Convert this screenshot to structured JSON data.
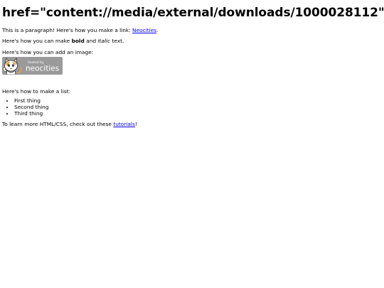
{
  "heading": "href=\"content://media/external/downloads/1000028112\"",
  "paragraph1": {
    "before": "This is a paragraph! Here's how you make a link: ",
    "link": "Neocities",
    "after": "."
  },
  "paragraph2": {
    "before": "Here's how you can make ",
    "bold": "bold",
    "middle": " and ",
    "italic": "italic",
    "after": " text."
  },
  "paragraph3": "Here's how you can add an image:",
  "badge": {
    "small_text": "hosted by",
    "brand_text": "neocities",
    "background_color": "#999999"
  },
  "paragraph4": "Here's how to make a list:",
  "list_items": [
    "First thing",
    "Second thing",
    "Third thing"
  ],
  "paragraph5": {
    "before": "To learn more HTML/CSS, check out these ",
    "link": "tutorials",
    "after": "!"
  },
  "colors": {
    "link": "#0000ee",
    "text": "#000000",
    "background": "#ffffff"
  }
}
